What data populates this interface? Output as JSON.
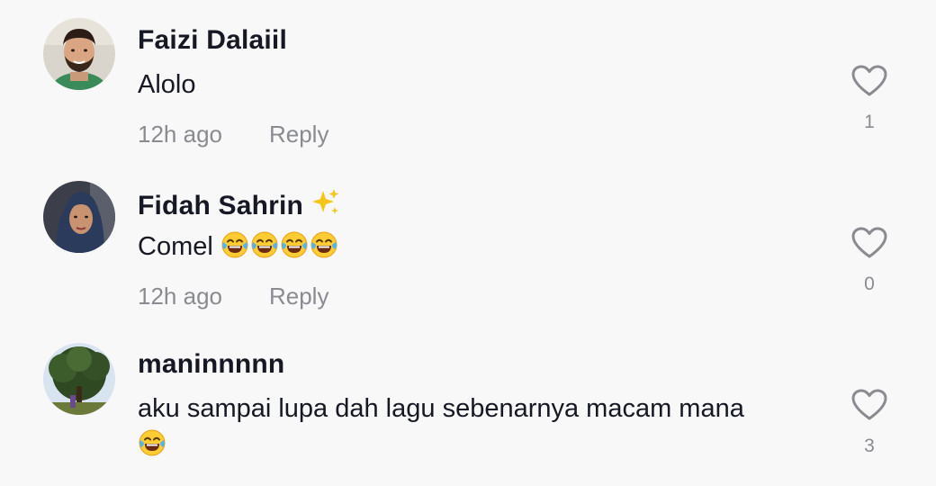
{
  "comments": [
    {
      "username": "Faizi Dalaiil",
      "text": "Alolo",
      "time": "12h ago",
      "reply_label": "Reply",
      "likes": "1",
      "avatar_icon": "avatar-man-beard"
    },
    {
      "username": "Fidah Sahrin",
      "username_emoji": "sparkles-emoji",
      "text": "Comel",
      "text_emoji": "face-with-tears-of-joy x4",
      "time": "12h ago",
      "reply_label": "Reply",
      "likes": "0",
      "avatar_icon": "avatar-woman-hijab"
    },
    {
      "username": "maninnnnn",
      "text": "aku sampai lupa dah lagu sebenarnya macam mana",
      "text_emoji": "face-with-tears-of-joy",
      "likes": "3",
      "avatar_icon": "avatar-tree-photo"
    }
  ],
  "colors": {
    "background": "#f8f8f8",
    "primary_text": "#161823",
    "secondary_text": "#8a8b91",
    "heart_outline": "#8a8b91"
  }
}
